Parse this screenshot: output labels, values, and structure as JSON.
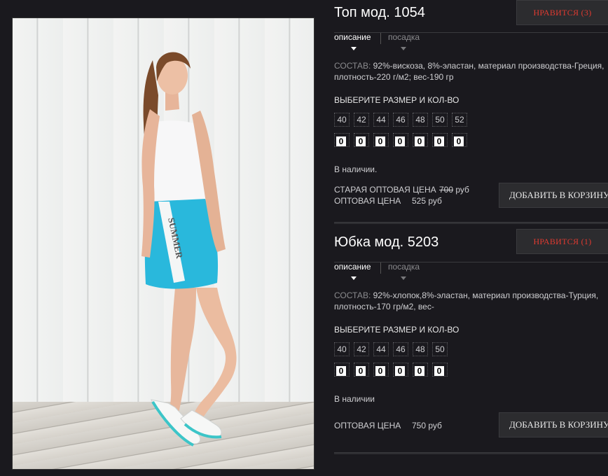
{
  "photo": {
    "shorts_text": "SUMMER"
  },
  "products": [
    {
      "title": "Топ мод. 1054",
      "like_label": "НРАВИТСЯ (3)",
      "tabs": [
        "описание",
        "посадка"
      ],
      "composition_label": "СОСТАВ:",
      "composition_line1": " 92%-вискоза, 8%-эластан, материал производства-Греция,",
      "composition_line2": "плотность-220 г/м2; вес-190 гр",
      "size_title": "ВЫБЕРИТЕ РАЗМЕР И КОЛ-ВО",
      "sizes": [
        "40",
        "42",
        "44",
        "46",
        "48",
        "50",
        "52"
      ],
      "quantities": [
        "0",
        "0",
        "0",
        "0",
        "0",
        "0",
        "0"
      ],
      "stock": "В наличии.",
      "old_price_label": "СТАРАЯ ОПТОВАЯ ЦЕНА",
      "old_price": "700",
      "old_price_unit": " руб",
      "price_label": "ОПТОВАЯ ЦЕНА",
      "price": "525 руб",
      "cart_label": "ДОБАВИТЬ В КОРЗИНУ"
    },
    {
      "title": "Юбка мод. 5203",
      "like_label": "НРАВИТСЯ (1)",
      "tabs": [
        "описание",
        "посадка"
      ],
      "composition_label": "СОСТАВ:",
      "composition_line1": " 92%-хлопок,8%-эластан, материал производства-Турция,",
      "composition_line2": "плотность-170 гр/м2, вес-",
      "size_title": "ВЫБЕРИТЕ РАЗМЕР И КОЛ-ВО",
      "sizes": [
        "40",
        "42",
        "44",
        "46",
        "48",
        "50"
      ],
      "quantities": [
        "0",
        "0",
        "0",
        "0",
        "0",
        "0"
      ],
      "stock": "В наличии",
      "price_label": "ОПТОВАЯ ЦЕНА",
      "price": "750 руб",
      "cart_label": "ДОБАВИТЬ В КОРЗИНУ"
    }
  ],
  "colors": {
    "background": "#1a191e",
    "like_text": "#e03a30",
    "button_bg": "#2c2c2f",
    "skirt": "#29b8dc"
  }
}
